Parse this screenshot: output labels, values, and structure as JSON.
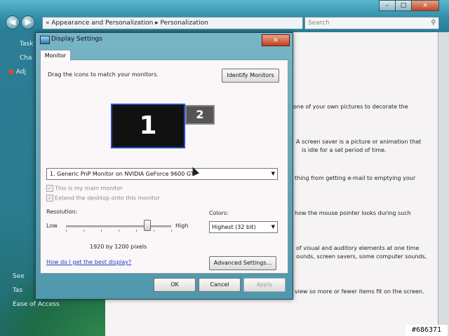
{
  "bg_window": {
    "breadcrumb": "« Appearance and Personalization ▸ Personalization",
    "search_placeholder": "Search",
    "caption_minimize": "–",
    "caption_maximize": "□",
    "caption_close": "×",
    "back_label": "◀",
    "forward_label": "▶",
    "taskpane": {
      "heading": "Task",
      "item1": "Cha",
      "item2": "Adj",
      "see_also": "See",
      "item3": "Tas",
      "ease": "Ease of Access"
    },
    "content_lines": [
      "one of your own pictures to decorate the",
      "A screen saver is a picture or animation that",
      "is idle for a set period of time.",
      "thing from getting e-mail to emptying your",
      "how the mouse pointer looks during such",
      "of visual and auditory elements at one time",
      "ounds, screen savers, some computer sounds,",
      "view so more or fewer items fit on the screen."
    ]
  },
  "dialog": {
    "title": "Display Settings",
    "close_label": "×",
    "tab": "Monitor",
    "instruction": "Drag the icons to match your monitors.",
    "identify_button": "Identify Monitors",
    "monitor1": "1",
    "monitor2": "2",
    "monitor_select": "1. Generic PnP Monitor on NVIDIA GeForce 9600 GT",
    "check_main": "This is my main monitor",
    "check_extend": "Extend the desktop onto this monitor",
    "resolution_label": "Resolution:",
    "low_label": "Low",
    "high_label": "High",
    "resolution_value": "1920 by 1200 pixels",
    "colors_label": "Colors:",
    "colors_value": "Highest (32 bit)",
    "help_link": "How do I get the best display?",
    "advanced_button": "Advanced Settings...",
    "ok_button": "OK",
    "cancel_button": "Cancel",
    "apply_button": "Apply"
  },
  "watermark": "#686371",
  "icons": [
    "back-icon",
    "forward-icon",
    "search-icon",
    "display-icon",
    "dropdown-icon"
  ],
  "colors": {
    "accent_blue": "#2a49c8",
    "link": "#1a3fbf",
    "close_red": "#c3401f"
  }
}
